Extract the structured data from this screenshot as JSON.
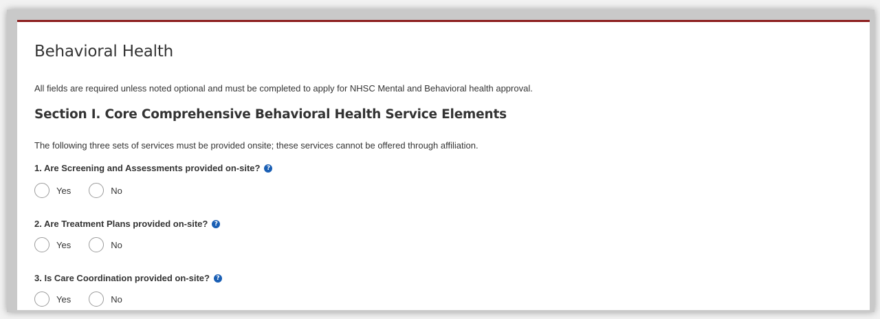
{
  "page": {
    "title": "Behavioral Health",
    "intro": "All fields are required unless noted optional and must be completed to apply for NHSC Mental and Behavioral health approval."
  },
  "section": {
    "heading": "Section I. Core Comprehensive Behavioral Health Service Elements",
    "description": "The following three sets of services must be provided onsite; these services cannot be offered through affiliation."
  },
  "questions": [
    {
      "text": "1. Are Screening and Assessments provided on-site?",
      "options": [
        "Yes",
        "No"
      ]
    },
    {
      "text": "2. Are Treatment Plans provided on-site?",
      "options": [
        "Yes",
        "No"
      ]
    },
    {
      "text": "3. Is Care Coordination provided on-site?",
      "options": [
        "Yes",
        "No"
      ]
    }
  ],
  "help_icon": {
    "name": "question-circle-icon",
    "glyph": "?"
  },
  "colors": {
    "accent_border": "#8b1a1a",
    "help_icon": "#1a5fb4",
    "text": "#333333"
  }
}
